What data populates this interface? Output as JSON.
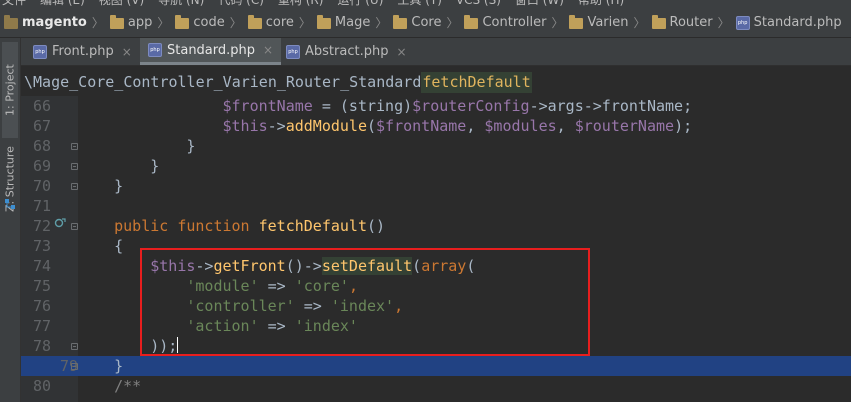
{
  "menu": {
    "items": [
      "文件",
      "编辑 (E)",
      "视图 (V)",
      "导航 (N)",
      "代码 (C)",
      "重构 (R)",
      "运行 (U)",
      "工具 (T)",
      "VCS (S)",
      "窗口 (W)",
      "帮助 (H)"
    ]
  },
  "navbar": {
    "crumbs": [
      {
        "label": "magento",
        "icon": "folder-icon"
      },
      {
        "label": "app",
        "icon": "folder-icon"
      },
      {
        "label": "code",
        "icon": "folder-icon"
      },
      {
        "label": "core",
        "icon": "folder-icon"
      },
      {
        "label": "Mage",
        "icon": "folder-icon"
      },
      {
        "label": "Core",
        "icon": "folder-icon"
      },
      {
        "label": "Controller",
        "icon": "folder-icon"
      },
      {
        "label": "Varien",
        "icon": "folder-icon"
      },
      {
        "label": "Router",
        "icon": "folder-icon"
      },
      {
        "label": "Standard.php",
        "icon": "php-file-icon"
      }
    ],
    "separator": "〉"
  },
  "sidebar": {
    "project_label": "1: Project",
    "structure_label": "Z: Structure"
  },
  "tabs": [
    {
      "label": "Front.php",
      "close": "×",
      "active": false
    },
    {
      "label": "Standard.php",
      "close": "×",
      "active": true
    },
    {
      "label": "Abstract.php",
      "close": "×",
      "active": false
    }
  ],
  "breadcrumb": {
    "class_path": "\\Mage_Core_Controller_Varien_Router_Standard",
    "method": "fetchDefault"
  },
  "line_numbers": [
    "66",
    "67",
    "68",
    "69",
    "70",
    "71",
    "72",
    "73",
    "74",
    "75",
    "76",
    "77",
    "78",
    "79",
    "80"
  ],
  "code": {
    "l66": {
      "indent": "                ",
      "v1": "$frontName",
      "t1": " = (string)",
      "v2": "$routerConfig",
      "t2": "->args->frontName;"
    },
    "l67": {
      "indent": "                ",
      "v1": "$this",
      "t1": "->",
      "f1": "addModule",
      "t2": "(",
      "v2": "$frontName",
      "t3": ", ",
      "v3": "$modules",
      "t4": ", ",
      "v4": "$routerName",
      "t5": ");"
    },
    "l68": {
      "text": "            }"
    },
    "l69": {
      "text": "        }"
    },
    "l70": {
      "text": "    }"
    },
    "l71": {
      "text": ""
    },
    "l72": {
      "indent": "    ",
      "k1": "public function ",
      "f1": "fetchDefault",
      "t1": "()"
    },
    "l73": {
      "text": "    {"
    },
    "l74": {
      "indent": "        ",
      "v1": "$this",
      "t1": "->",
      "f1": "getFront",
      "t2": "()->",
      "f2": "setDefault",
      "t3": "(",
      "k1": "array",
      "t4": "("
    },
    "l75": {
      "indent": "            ",
      "s1": "'module'",
      "t1": " => ",
      "s2": "'core'",
      "t2": ","
    },
    "l76": {
      "indent": "            ",
      "s1": "'controller'",
      "t1": " => ",
      "s2": "'index'",
      "t2": ","
    },
    "l77": {
      "indent": "            ",
      "s1": "'action'",
      "t1": " => ",
      "s2": "'index'"
    },
    "l78": {
      "text": "        ));"
    },
    "l79": {
      "text": "    }"
    },
    "l80": {
      "indent": "    ",
      "c1": "/**"
    }
  },
  "colors": {
    "keyword": "#cc7832",
    "variable": "#9876aa",
    "function": "#ffc66d",
    "string": "#6a8759",
    "highlight_box": "#e81e1e",
    "current_line": "#214283"
  }
}
